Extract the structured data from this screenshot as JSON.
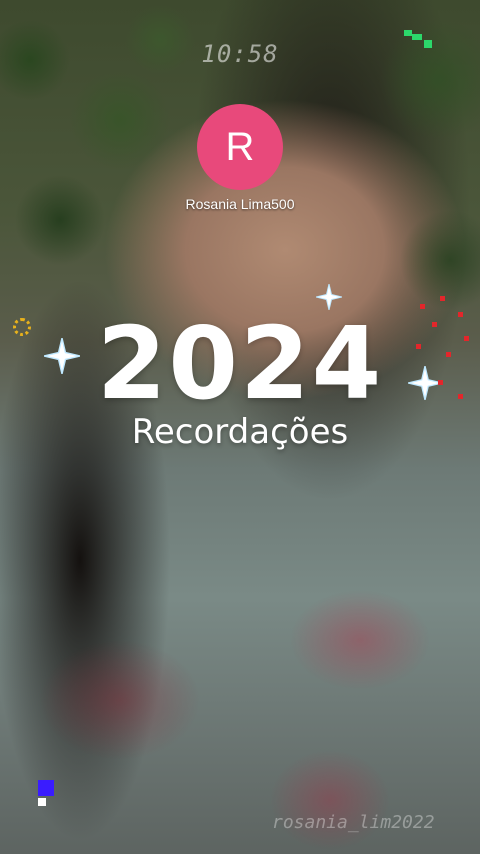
{
  "status": {
    "time": "10:58"
  },
  "profile": {
    "avatar_letter": "R",
    "name": "Rosania Lima500",
    "avatar_color": "#e8497b"
  },
  "overlay": {
    "year": "2024",
    "subtitle": "Recordações"
  },
  "watermark": {
    "text": "rosania_lim2022"
  },
  "decorations": {
    "sparkle_icon": "four-point-sparkle",
    "accent_colors": {
      "sparkle_core": "#ffffff",
      "sparkle_glow": "#bfe8ff",
      "ring": "#e8b21c",
      "dots": "#e3262b",
      "corner_pixels": "#2cd86b",
      "bottom_pixel": "#3a1cff"
    }
  }
}
